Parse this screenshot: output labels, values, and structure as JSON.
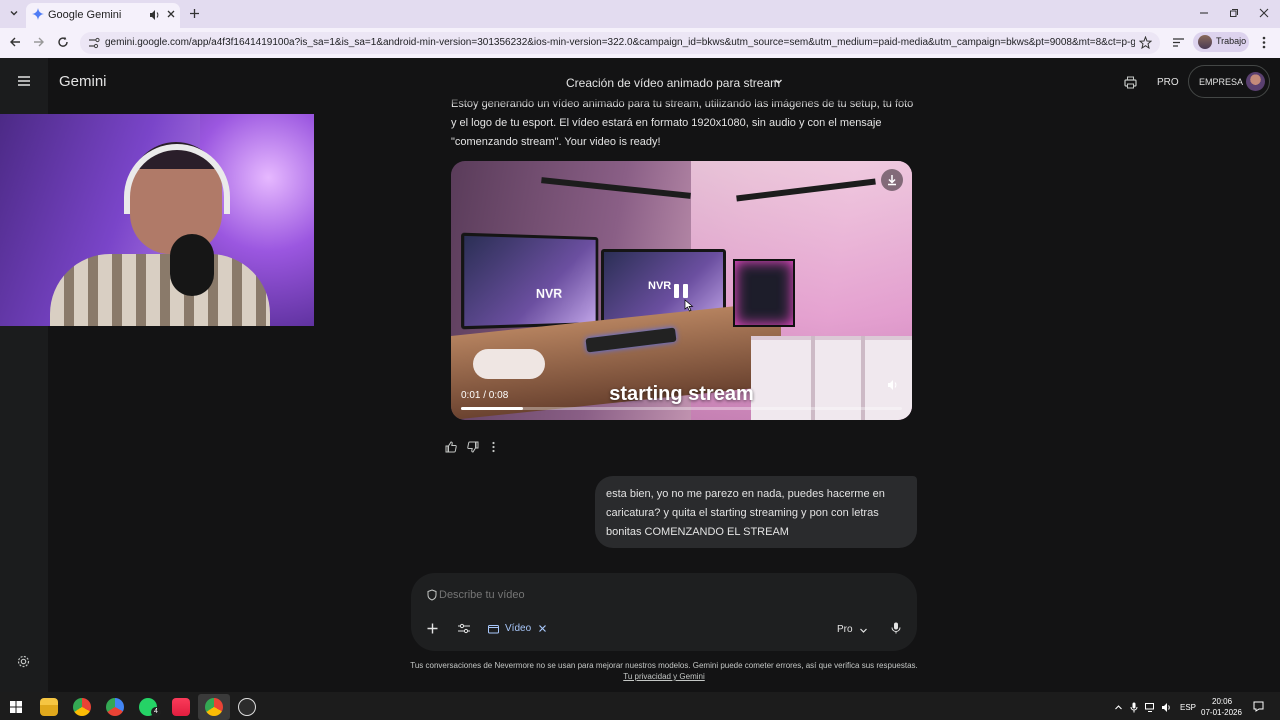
{
  "browser": {
    "tab_title": "Google Gemini",
    "url": "gemini.google.com/app/a4f3f1641419100a?is_sa=1&is_sa=1&android-min-version=301356232&ios-min-version=322.0&campaign_id=bkws&utm_source=sem&utm_medium=paid-media&utm_campaign=bkws&pt=9008&mt=8&ct=p-growth-se...",
    "profile_label": "Trabajo"
  },
  "header": {
    "app_name": "Gemini",
    "conversation_title": "Creación de vídeo animado para stream",
    "pro_label": "PRO",
    "empresa_label": "EMPRESA"
  },
  "response": {
    "line1": "Estoy generando un vídeo animado para tu stream, utilizando las imágenes de tu setup, tu foto",
    "line2": "y el logo de tu esport. El vídeo estará en formato 1920x1080, sin audio y con el mensaje",
    "line3": "\"comenzando stream\". Your video is ready!"
  },
  "video": {
    "caption": "starting stream",
    "time_display": "0:01 / 0:08",
    "progress_fraction": 0.14,
    "logo_text": "NVR"
  },
  "user_message": {
    "line1": "esta bien, yo no me parezo en nada, puedes hacerme en",
    "line2": "caricatura? y quita el starting streaming y pon con letras",
    "line3": "bonitas COMENZANDO EL STREAM"
  },
  "composer": {
    "placeholder": "Describe tu vídeo",
    "tool_chip_label": "Vídeo",
    "model_label": "Pro"
  },
  "footer": {
    "disclaimer": "Tus conversaciones de Nevermore no se usan para mejorar nuestros modelos. Gemini puede cometer errores, así que verifica sus respuestas.",
    "privacy_link": "Tu privacidad y Gemini"
  },
  "taskbar": {
    "lang": "ESP",
    "time": "20:06",
    "date": "07-01-2026",
    "whatsapp_badge": "4"
  },
  "colors": {
    "background": "#131314",
    "sidebar": "#1b1c1d",
    "bubble": "#2a2b2d",
    "accent_blue": "#a8c7fa",
    "browser_chrome": "#e3dcf0"
  }
}
